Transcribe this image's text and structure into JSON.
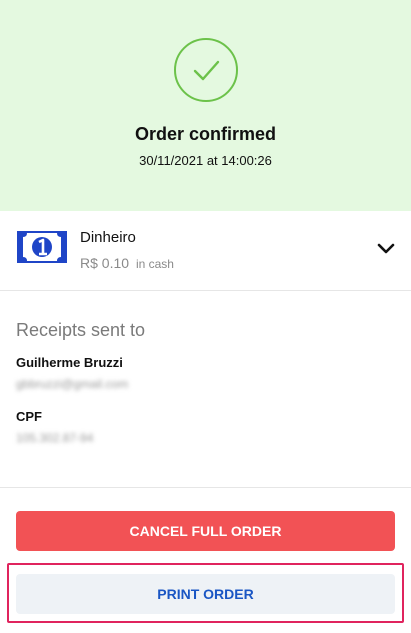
{
  "header": {
    "title": "Order confirmed",
    "datetime": "30/11/2021 at 14:00:26",
    "status_icon": "check-circle-icon",
    "accent_color": "#6cc24a",
    "background_color": "#e4f9e0"
  },
  "payment": {
    "method": "Dinheiro",
    "amount": "R$ 0.10",
    "amount_note": "in cash",
    "icon": "cash-bill-icon",
    "expand_icon": "chevron-down-icon"
  },
  "receipts": {
    "title": "Receipts sent to",
    "customer_name": "Guilherme Bruzzi",
    "customer_email": "gbbruzzi@gmail.com",
    "cpf_label": "CPF",
    "cpf_value": "105.302.87-94"
  },
  "actions": {
    "cancel_label": "CANCEL FULL ORDER",
    "cancel_color": "#f25255",
    "print_label": "PRINT ORDER",
    "print_color": "#1a56c4"
  }
}
